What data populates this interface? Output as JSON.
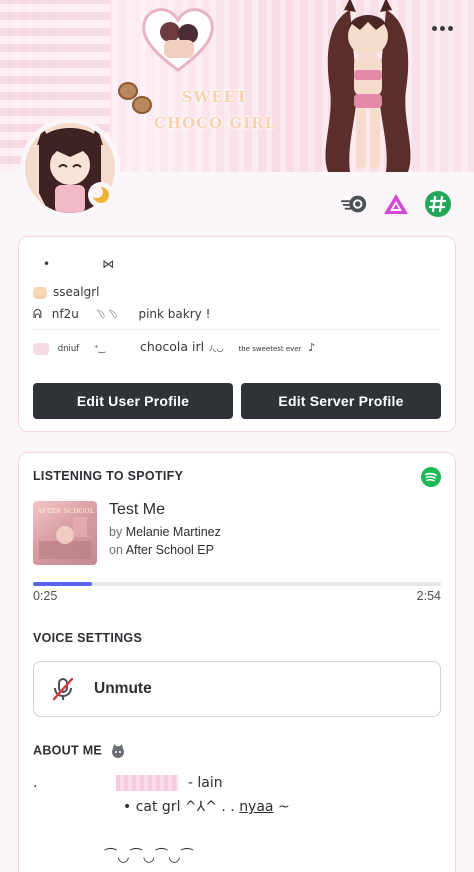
{
  "banner": {
    "title_line1": "SWEET",
    "title_line2": "CHOCO GIRL"
  },
  "header": {
    "more_icon": "more-dots-icon",
    "status_icon": "moon-idle-icon"
  },
  "badges": [
    {
      "name": "nitro-badge-icon"
    },
    {
      "name": "hypesquad-badge-icon"
    },
    {
      "name": "hashtag-badge-icon"
    }
  ],
  "profile": {
    "line_top": "•",
    "line_top_symbol": "⋈",
    "username": "ssealgrl",
    "bio_prefix": "ᕱ",
    "bio_handle": "nf2u",
    "bio_mid": "﹆﹆",
    "bio_text": "pink bakry !",
    "tag_1": "dniuf",
    "tag_1_deco": "⁺‿",
    "tag_2": "chocola irl",
    "tag_2_deco": "ﾉ◟◡",
    "tag_3": "the sweetest ever",
    "tag_3_deco": "♪",
    "edit_user_profile": "Edit User Profile",
    "edit_server_profile": "Edit Server Profile"
  },
  "spotify": {
    "heading": "LISTENING TO SPOTIFY",
    "album_text": "AFTER SCHOOL",
    "track_title": "Test Me",
    "by_prefix": "by",
    "artist": "Melanie Martinez",
    "on_prefix": "on",
    "album": "After School EP",
    "elapsed": "0:25",
    "duration": "2:54",
    "progress": 0.144,
    "accent": "#5865f2",
    "brand": "#1db954"
  },
  "voice": {
    "heading": "VOICE SETTINGS",
    "unmute_label": "Unmute",
    "icon": "mic-muted-icon"
  },
  "about": {
    "heading": "ABOUT ME",
    "line1_lead": ".",
    "line1_text": "- lain",
    "line2_text": "• cat grl ^⅄^ .  .",
    "line2_link": "nyaa",
    "line2_tail": "~",
    "line3": "⁀◡⁀◡⁀◡⁀"
  }
}
